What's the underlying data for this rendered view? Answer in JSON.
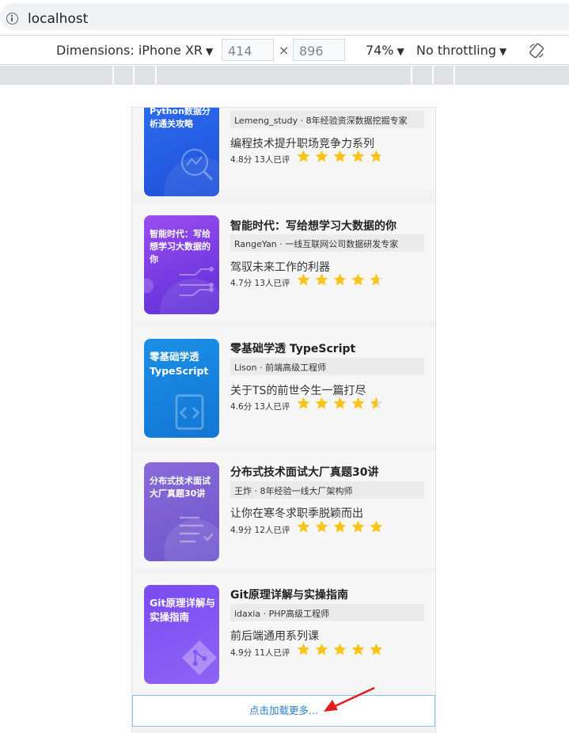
{
  "browser": {
    "url": "localhost"
  },
  "device_toolbar": {
    "dimensions_label": "Dimensions: iPhone XR",
    "width": "414",
    "height": "896",
    "times": "×",
    "zoom": "74%",
    "throttling": "No throttling"
  },
  "courses": [
    {
      "thumb_title": "Python数据分析通关攻略",
      "title": "",
      "author": "Lemeng_study · 8年经验资深数据挖掘专家",
      "desc": "编程技术提升职场竞争力系列",
      "score": "4.8分",
      "count": "13人已评",
      "rating": 4.8,
      "color1": "#2d6ef0",
      "color2": "#1e4fd8"
    },
    {
      "thumb_title": "智能时代：写给想学习大数据的你",
      "title": "智能时代：写给想学习大数据的你",
      "author": "RangeYan · 一线互联网公司数据研发专家",
      "desc": "驾驭未来工作的利器",
      "score": "4.7分",
      "count": "13人已评",
      "rating": 4.7,
      "color1": "#9b4df0",
      "color2": "#5b2ed6"
    },
    {
      "thumb_title": "零基础学透TypeScript",
      "title": "零基础学透 TypeScript",
      "author": "Lison · 前端高级工程师",
      "desc": "关于TS的前世今生一篇打尽",
      "score": "4.6分",
      "count": "13人已评",
      "rating": 4.6,
      "color1": "#1c8fe6",
      "color2": "#1276d4"
    },
    {
      "thumb_title": "分布式技术面试大厂真题30讲",
      "title": "分布式技术面试大厂真题30讲",
      "author": "王炸 · 8年经验一线大厂架构师",
      "desc": "让你在寒冬求职季脱颖而出",
      "score": "4.9分",
      "count": "12人已评",
      "rating": 4.9,
      "color1": "#8a6ad8",
      "color2": "#6d55cc"
    },
    {
      "thumb_title": "Git原理详解与实操指南",
      "title": "Git原理详解与实操指南",
      "author": "idaxia · PHP高级工程师",
      "desc": "前后端通用系列课",
      "score": "4.9分",
      "count": "11人已评",
      "rating": 4.9,
      "color1": "#7a4cf2",
      "color2": "#8e63f5"
    }
  ],
  "load_more": "点击加载更多...",
  "colors": {
    "star": "#fcc419",
    "star_empty": "#e0e0e0",
    "link": "#2b7fcf",
    "arrow": "#e21d1d"
  }
}
